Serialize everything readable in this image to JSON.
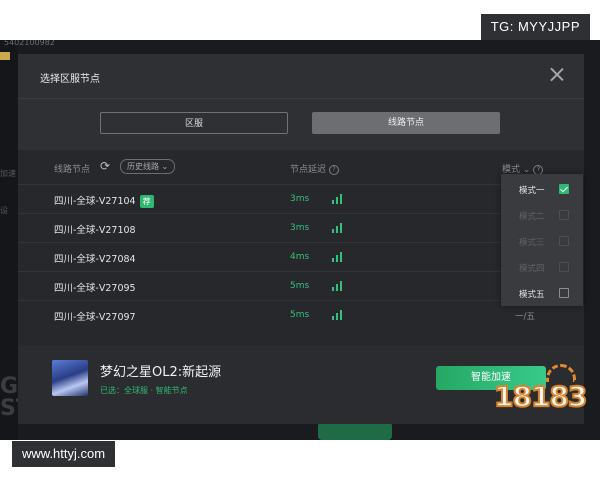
{
  "background": {
    "id_text": "5402100982",
    "side_labels": [
      "加速",
      "设"
    ],
    "big_letters": [
      "GA",
      "ST"
    ]
  },
  "watermarks": {
    "tg": "TG: MYYJJPP",
    "url": "www.httyj.com"
  },
  "dialog": {
    "title": "选择区服节点",
    "tabs": [
      {
        "label": "区服",
        "active": false
      },
      {
        "label": "线路节点",
        "active": true
      }
    ],
    "table": {
      "headers": {
        "node": "线路节点",
        "history": "历史线路",
        "latency": "节点延迟",
        "mode": "模式"
      },
      "rows": [
        {
          "name": "四川-全球-V27104",
          "badge": "荐",
          "latency": "3ms",
          "mode": ""
        },
        {
          "name": "四川-全球-V27108",
          "badge": "",
          "latency": "3ms",
          "mode": ""
        },
        {
          "name": "四川-全球-V27084",
          "badge": "",
          "latency": "4ms",
          "mode": ""
        },
        {
          "name": "四川-全球-V27095",
          "badge": "",
          "latency": "5ms",
          "mode": ""
        },
        {
          "name": "四川-全球-V27097",
          "badge": "",
          "latency": "5ms",
          "mode": "一/五"
        }
      ]
    },
    "mode_options": [
      {
        "label": "模式一",
        "checked": true,
        "enabled": true
      },
      {
        "label": "模式二",
        "checked": false,
        "enabled": false
      },
      {
        "label": "模式三",
        "checked": false,
        "enabled": false
      },
      {
        "label": "模式四",
        "checked": false,
        "enabled": false
      },
      {
        "label": "模式五",
        "checked": false,
        "enabled": true
      }
    ],
    "footer": {
      "game_title": "梦幻之星OL2:新起源",
      "selected": "已选：全球服 · 智能节点",
      "accelerate_button": "智能加速"
    }
  },
  "logo": {
    "text": "18183"
  },
  "colors": {
    "accent": "#2fb872",
    "dialog_bg": "#2f3034",
    "table_bg": "#27282b"
  }
}
